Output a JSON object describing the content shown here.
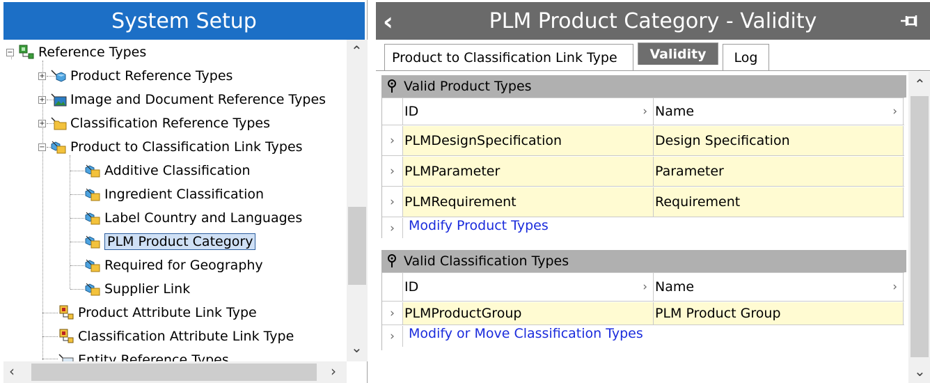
{
  "left_panel": {
    "title": "System Setup",
    "tree": [
      {
        "label": "Reference Types",
        "icon": "reference-types-icon",
        "expander": "−"
      },
      {
        "label": "Product Reference Types",
        "icon": "product-reference-icon",
        "expander": "+"
      },
      {
        "label": "Image and Document Reference Types",
        "icon": "image-reference-icon",
        "expander": "+"
      },
      {
        "label": "Classification Reference Types",
        "icon": "folder-reference-icon",
        "expander": "+"
      },
      {
        "label": "Product to Classification Link Types",
        "icon": "link-type-icon",
        "expander": "−"
      },
      {
        "label": "Additive Classification",
        "icon": "link-type-icon"
      },
      {
        "label": "Ingredient Classification",
        "icon": "link-type-icon"
      },
      {
        "label": "Label Country and Languages",
        "icon": "link-type-icon"
      },
      {
        "label": "PLM Product Category",
        "icon": "link-type-icon",
        "selected": true
      },
      {
        "label": "Required for Geography",
        "icon": "link-type-icon"
      },
      {
        "label": "Supplier Link",
        "icon": "link-type-icon"
      },
      {
        "label": "Product Attribute Link Type",
        "icon": "attribute-link-icon"
      },
      {
        "label": "Classification Attribute Link Type",
        "icon": "attribute-link-icon"
      },
      {
        "label": "Entity Reference Types",
        "icon": "entity-reference-icon"
      }
    ]
  },
  "right_panel": {
    "title": "PLM Product Category - Validity",
    "tabs": [
      {
        "label": "Product to Classification Link Type",
        "active": false
      },
      {
        "label": "Validity",
        "active": true
      },
      {
        "label": "Log",
        "active": false
      }
    ],
    "sections": [
      {
        "header": "Valid Product Types",
        "columns": [
          "ID",
          "Name"
        ],
        "rows": [
          {
            "id": "PLMDesignSpecification",
            "name": "Design Specification"
          },
          {
            "id": "PLMParameter",
            "name": "Parameter"
          },
          {
            "id": "PLMRequirement",
            "name": "Requirement"
          }
        ],
        "action_link": "Modify Product Types"
      },
      {
        "header": "Valid Classification Types",
        "columns": [
          "ID",
          "Name"
        ],
        "rows": [
          {
            "id": "PLMProductGroup",
            "name": "PLM Product Group"
          }
        ],
        "action_link": "Modify or Move Classification Types"
      }
    ]
  },
  "colors": {
    "left_title_bg": "#1c6fc6",
    "right_title_bg": "#6a6a6a",
    "row_highlight": "#fffbd2",
    "link": "#1a2bdc"
  }
}
